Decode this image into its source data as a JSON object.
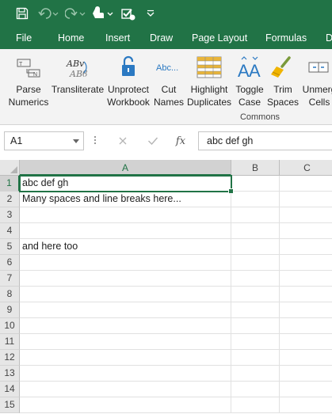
{
  "qat": {
    "icons": [
      "save-icon",
      "undo-icon",
      "redo-icon",
      "touch-mode-icon",
      "checklist-icon",
      "customize-qat-icon"
    ]
  },
  "tabs": [
    "File",
    "Home",
    "Insert",
    "Draw",
    "Page Layout",
    "Formulas",
    "D"
  ],
  "ribbon": {
    "buttons": [
      {
        "label": "Parse\nNumerics",
        "icon": "parse-numerics-icon"
      },
      {
        "label": "Transliterate",
        "icon": "transliterate-icon"
      },
      {
        "label": "Unprotect\nWorkbook",
        "icon": "unlock-icon"
      },
      {
        "label": "Cut\nNames",
        "icon": "cut-names-icon"
      },
      {
        "label": "Highlight\nDuplicates",
        "icon": "highlight-duplicates-icon"
      },
      {
        "label": "Toggle\nCase",
        "icon": "toggle-case-icon"
      },
      {
        "label": "Trim\nSpaces",
        "icon": "broom-icon"
      },
      {
        "label": "Unmerg\nCells",
        "icon": "unmerge-cells-icon"
      }
    ],
    "group_label": "Commons"
  },
  "formula_bar": {
    "name_box": "A1",
    "fx_label": "fx",
    "formula": "abc def gh"
  },
  "grid": {
    "columns": [
      "A",
      "B",
      "C"
    ],
    "selected_column": "A",
    "rows": [
      {
        "num": "1",
        "a": "abc def gh",
        "b": "",
        "c": ""
      },
      {
        "num": "2",
        "a": "Many spaces and line breaks here...",
        "b": "",
        "c": ""
      },
      {
        "num": "3",
        "a": "",
        "b": "",
        "c": ""
      },
      {
        "num": "4",
        "a": "",
        "b": "",
        "c": ""
      },
      {
        "num": "5",
        "a": "and here too",
        "b": "",
        "c": ""
      },
      {
        "num": "6",
        "a": "",
        "b": "",
        "c": ""
      },
      {
        "num": "7",
        "a": "",
        "b": "",
        "c": ""
      },
      {
        "num": "8",
        "a": "",
        "b": "",
        "c": ""
      },
      {
        "num": "9",
        "a": "",
        "b": "",
        "c": ""
      },
      {
        "num": "10",
        "a": "",
        "b": "",
        "c": ""
      },
      {
        "num": "11",
        "a": "",
        "b": "",
        "c": ""
      },
      {
        "num": "12",
        "a": "",
        "b": "",
        "c": ""
      },
      {
        "num": "13",
        "a": "",
        "b": "",
        "c": ""
      },
      {
        "num": "14",
        "a": "",
        "b": "",
        "c": ""
      },
      {
        "num": "15",
        "a": "",
        "b": "",
        "c": ""
      }
    ],
    "selected_row": "1"
  },
  "colors": {
    "accent": "#217346",
    "ribbon_bg": "#f3f3f3"
  }
}
